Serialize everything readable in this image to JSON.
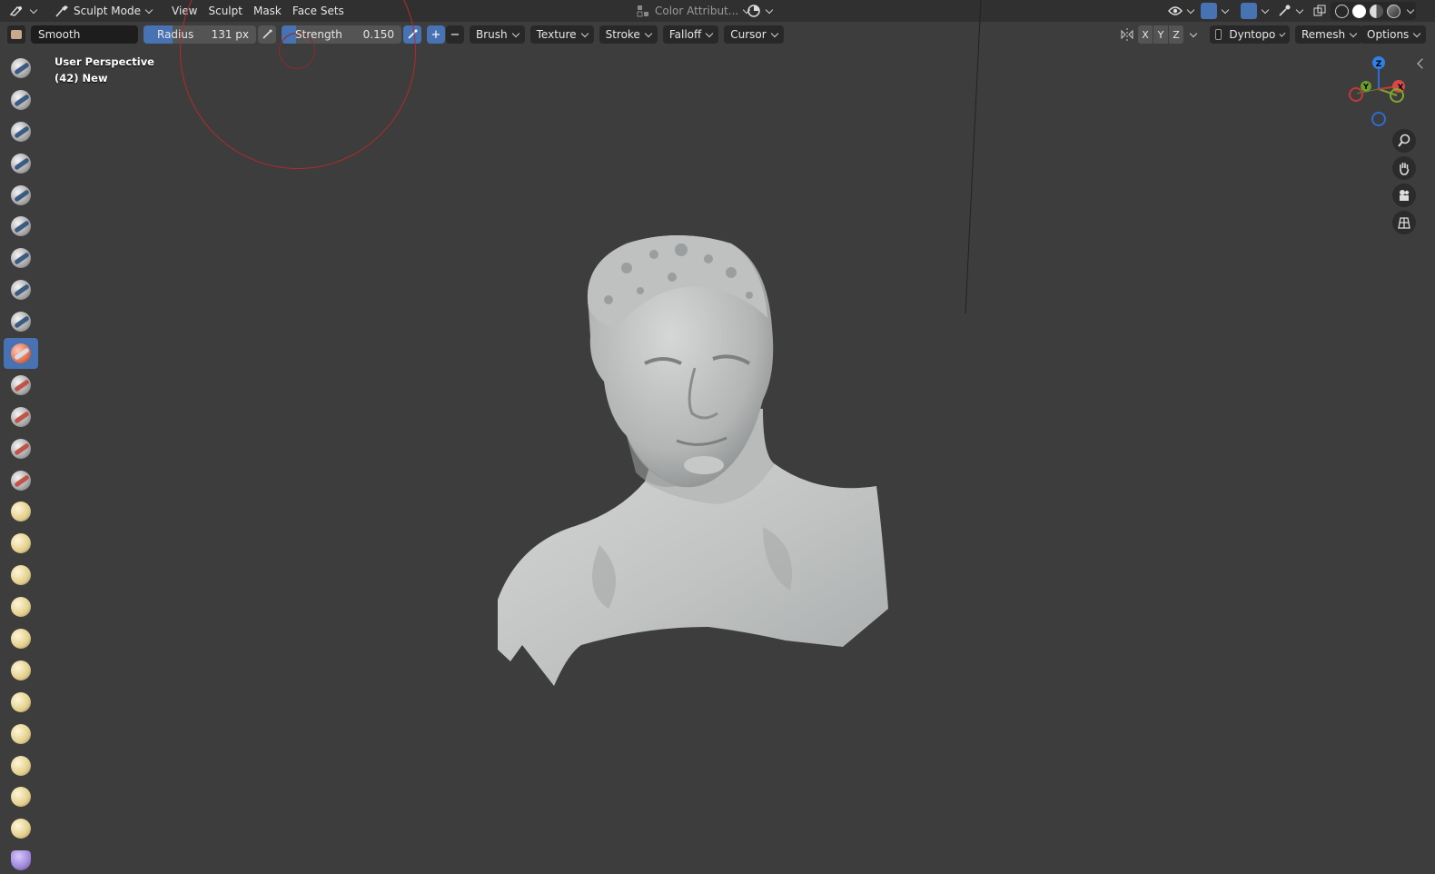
{
  "header": {
    "mode_label": "Sculpt Mode",
    "menus": [
      "View",
      "Sculpt",
      "Mask",
      "Face Sets"
    ],
    "color_attribute_label": "Color Attribut..."
  },
  "tool_settings": {
    "brush_name": "Smooth",
    "radius_label": "Radius",
    "radius_value": "131 px",
    "strength_label": "Strength",
    "strength_value": "0.150",
    "strength_fraction": 0.15,
    "add_label": "+",
    "subtract_label": "−",
    "dropdowns": [
      "Brush",
      "Texture",
      "Stroke",
      "Falloff",
      "Cursor"
    ],
    "symmetry_axes": [
      "X",
      "Y",
      "Z"
    ],
    "dyntopo_label": "Dyntopo",
    "remesh_label": "Remesh",
    "options_label": "Options"
  },
  "viewport": {
    "view_name": "User Perspective",
    "object_info": "(42) New"
  },
  "gizmo": {
    "z": "Z",
    "y": "Y",
    "x": "X"
  },
  "toolbar": {
    "tools": [
      "draw-tool",
      "draw-sharp-tool",
      "clay-tool",
      "clay-strips-tool",
      "clay-thumb-tool",
      "layer-tool",
      "inflate-tool",
      "blob-tool",
      "crease-tool",
      "smooth-tool",
      "flatten-tool",
      "fill-tool",
      "scrape-tool",
      "multiplane-scrape-tool",
      "pinch-tool",
      "grab-tool",
      "elastic-deform-tool",
      "snake-hook-tool",
      "thumb-tool",
      "pose-tool",
      "nudge-tool",
      "rotate-tool",
      "slide-relax-tool",
      "boundary-tool",
      "cloth-tool",
      "simplify-tool",
      "mask-tool"
    ],
    "active_index": 9
  },
  "colors": {
    "accent": "#4772b3",
    "background": "#3d3d3d",
    "header": "#303030",
    "brush_circle": "#b52a2a"
  }
}
